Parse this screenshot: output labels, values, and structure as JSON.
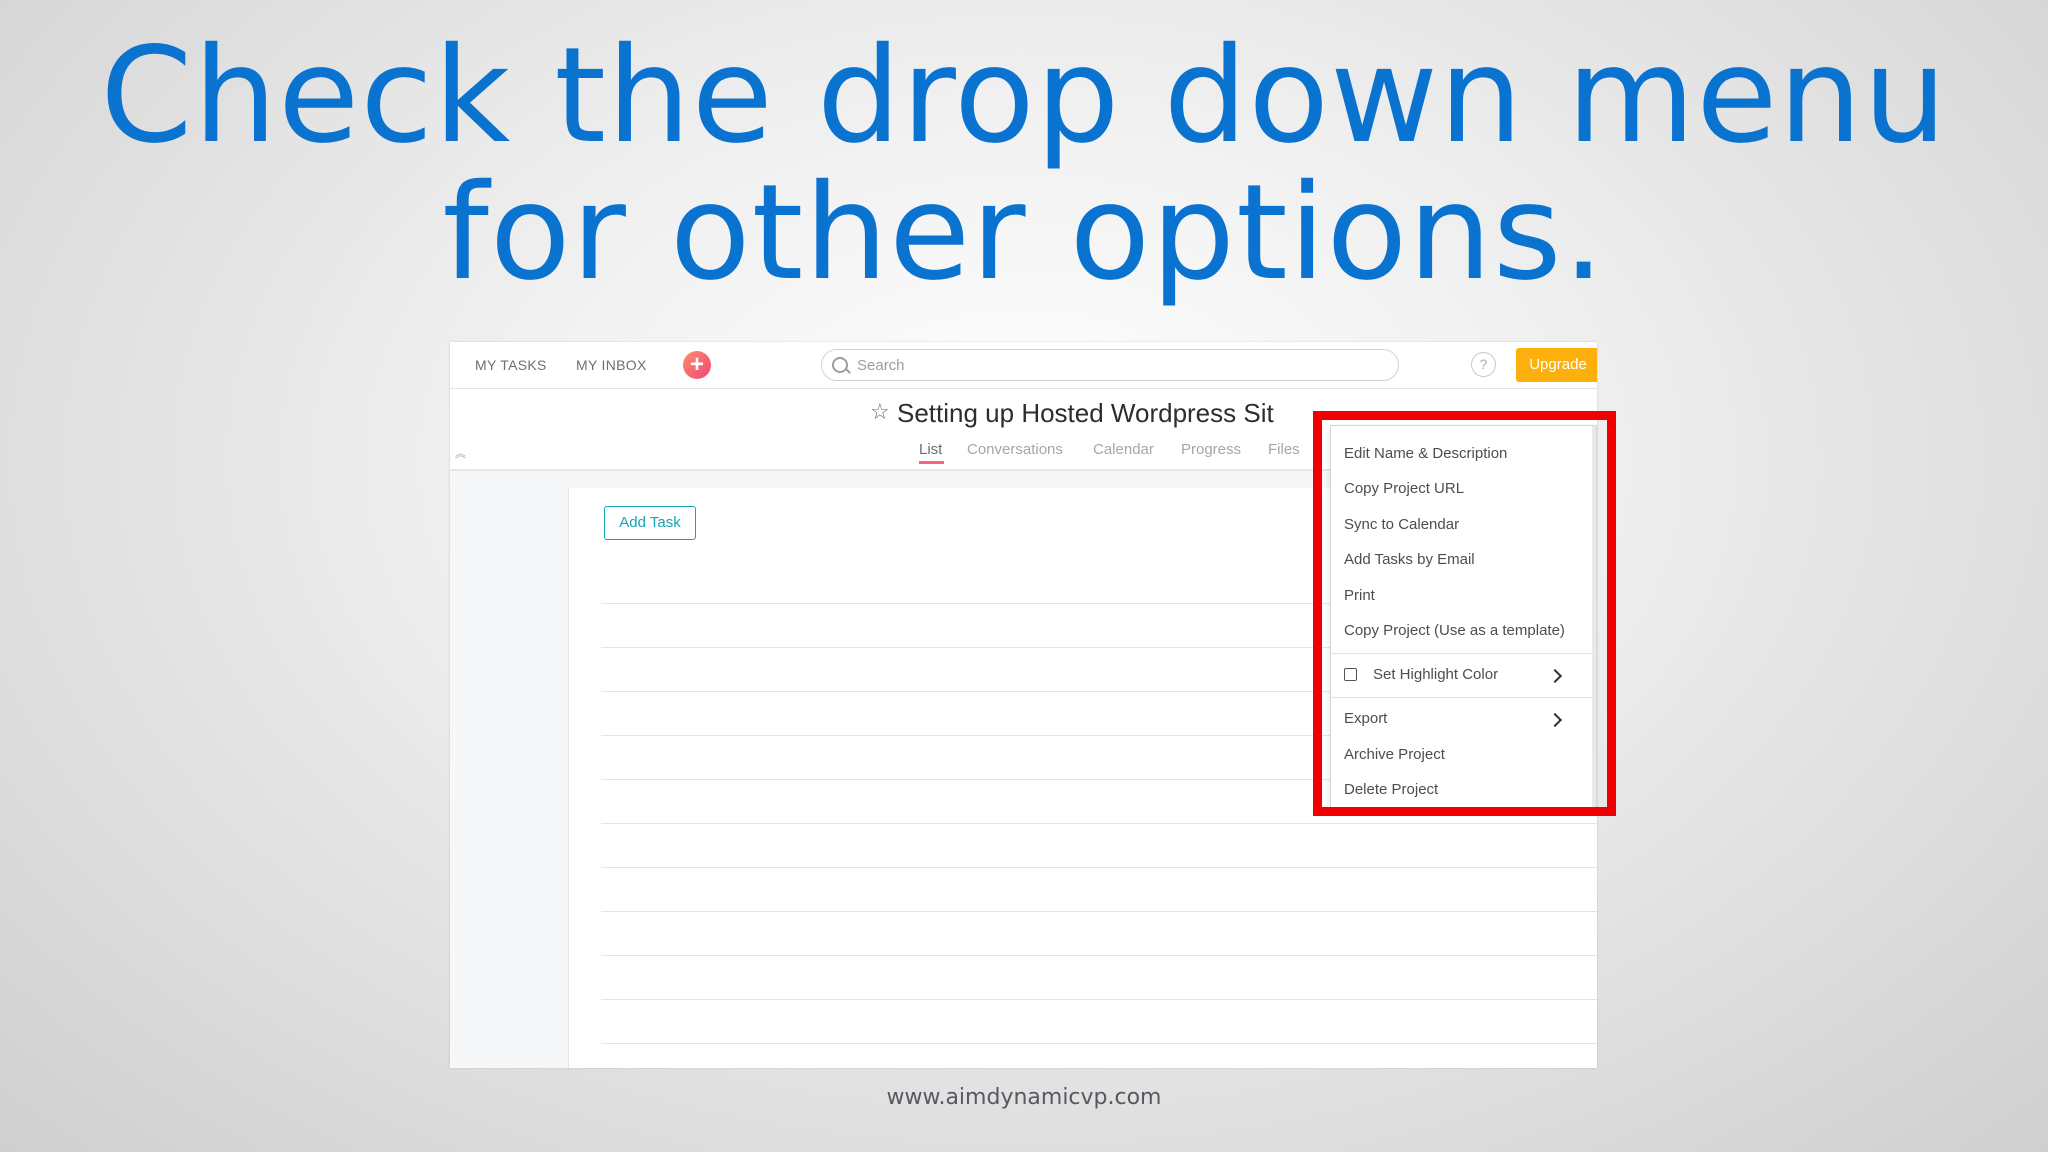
{
  "slide": {
    "title_line1": "Check the drop down menu",
    "title_line2": "for other options.",
    "footer_url": "www.aimdynamicvp.com",
    "highlight_color": "#f20000",
    "title_color": "#0a73d0"
  },
  "app": {
    "topbar": {
      "my_tasks": "MY TASKS",
      "my_inbox": "MY INBOX",
      "add_icon": "plus-icon",
      "search_placeholder": "Search",
      "help_label": "?",
      "upgrade_label": "Upgrade",
      "upgrade_color": "#fcb00e"
    },
    "project": {
      "title": "Setting up Hosted Wordpress Sit",
      "tabs": [
        "List",
        "Conversations",
        "Calendar",
        "Progress",
        "Files"
      ],
      "active_tab": "List"
    },
    "list": {
      "add_task_label": "Add Task"
    },
    "dropdown": {
      "items": [
        "Edit Name & Description",
        "Copy Project URL",
        "Sync to Calendar",
        "Add Tasks by Email",
        "Print",
        "Copy Project (Use as a template)",
        "Set Highlight Color",
        "Export",
        "Archive Project",
        "Delete Project"
      ]
    }
  }
}
